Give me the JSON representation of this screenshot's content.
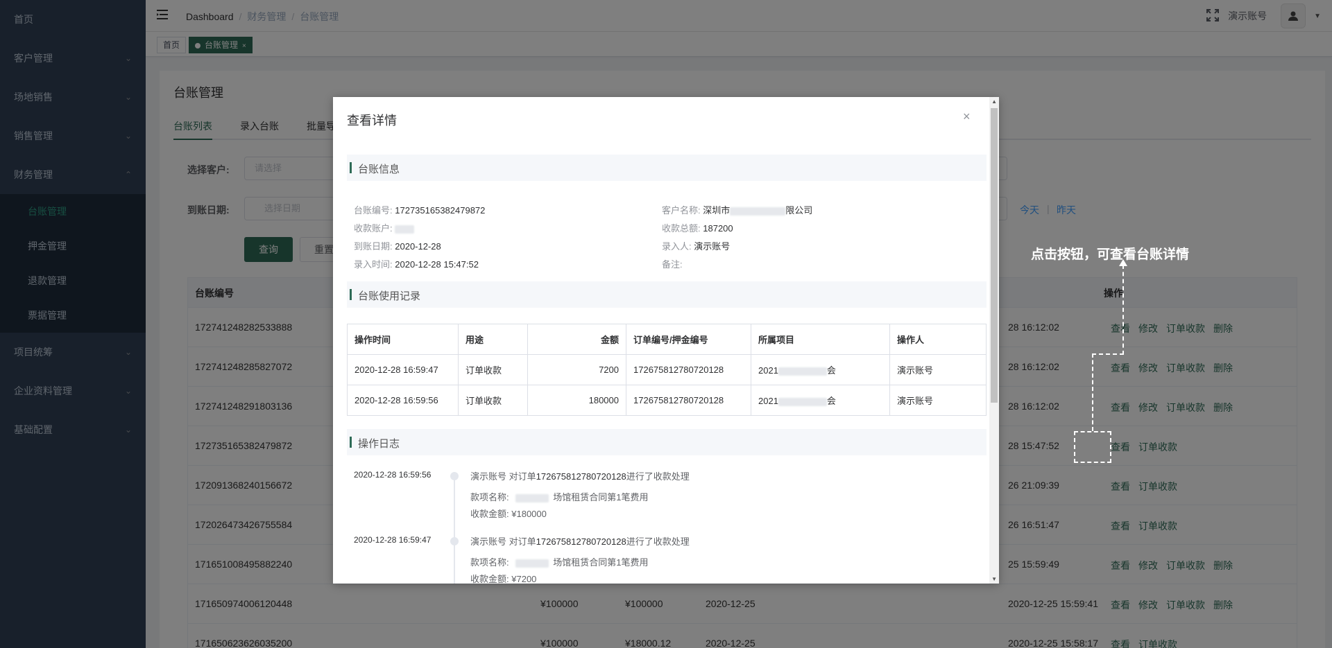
{
  "sidebar": {
    "items": [
      {
        "label": "首页",
        "has_arrow": false
      },
      {
        "label": "客户管理",
        "has_arrow": true
      },
      {
        "label": "场地销售",
        "has_arrow": true
      },
      {
        "label": "销售管理",
        "has_arrow": true
      },
      {
        "label": "财务管理",
        "has_arrow": true,
        "expanded": true
      }
    ],
    "sub_items": [
      {
        "label": "台账管理",
        "active": true
      },
      {
        "label": "押金管理"
      },
      {
        "label": "退款管理"
      },
      {
        "label": "票据管理"
      }
    ],
    "items_after": [
      {
        "label": "项目统筹"
      },
      {
        "label": "企业资料管理"
      },
      {
        "label": "基础配置"
      }
    ],
    "arrow_down": "⌄",
    "arrow_up": "⌃"
  },
  "navbar": {
    "breadcrumb": [
      "Dashboard",
      "财务管理",
      "台账管理"
    ],
    "username": "演示账号"
  },
  "tags": [
    {
      "label": "首页"
    },
    {
      "label": "台账管理",
      "active": true
    }
  ],
  "page": {
    "title": "台账管理",
    "tabs": [
      "台账列表",
      "录入台账",
      "批量导"
    ],
    "filters": {
      "customer_label": "选择客户:",
      "customer_placeholder": "请选择",
      "date_label": "到账日期:",
      "date_placeholder": "选择日期",
      "today": "今天",
      "yesterday": "昨天",
      "divider": "|"
    },
    "query_button": "查询",
    "reset_button": "重置"
  },
  "bg_table": {
    "headers": {
      "id": "台账编号",
      "ops": "操作"
    },
    "rows": [
      {
        "id": "172741248282533888",
        "time": "28 16:12:02",
        "ops": [
          "查看",
          "修改",
          "订单收款",
          "删除"
        ]
      },
      {
        "id": "172741248285827072",
        "time": "28 16:12:02",
        "ops": [
          "查看",
          "修改",
          "订单收款",
          "删除"
        ]
      },
      {
        "id": "172741248291803136",
        "time": "28 16:12:02",
        "ops": [
          "查看",
          "修改",
          "订单收款",
          "删除"
        ]
      },
      {
        "id": "172735165382479872",
        "time": "28 15:47:52",
        "ops": [
          "查看",
          "订单收款"
        ]
      },
      {
        "id": "172091368240156672",
        "time": "26 21:09:39",
        "ops": [
          "查看",
          "订单收款"
        ]
      },
      {
        "id": "172026473426755584",
        "time": "26 16:51:47",
        "ops": [
          "查看",
          "订单收款"
        ]
      },
      {
        "id": "171651008495882240",
        "time": "25 15:59:49",
        "ops": [
          "查看",
          "修改",
          "订单收款",
          "删除"
        ]
      },
      {
        "id": "171650974006120448",
        "time": "2020-12-25 15:59:41",
        "ops": [
          "查看",
          "修改",
          "订单收款",
          "删除"
        ],
        "amount1": "¥100000",
        "amount2": "¥100000",
        "date": "2020-12-25"
      },
      {
        "id": "171650623626035200",
        "time": "2020-12-25 15:58:17",
        "ops": [
          "查看",
          "订单收款"
        ],
        "amount1": "¥100000",
        "amount2": "¥18000.12",
        "date": "2020-12-25"
      }
    ]
  },
  "dialog": {
    "title": "查看详情",
    "close": "×",
    "sections": {
      "info": "台账信息",
      "usage": "台账使用记录",
      "log": "操作日志"
    },
    "info": {
      "ledger_no_label": "台账编号:",
      "ledger_no": "172735165382479872",
      "customer_label": "客户名称:",
      "customer_prefix": "深圳市",
      "customer_suffix": "限公司",
      "account_label": "收款账户:",
      "total_label": "收款总额:",
      "total": "187200",
      "arrival_label": "到账日期:",
      "arrival": "2020-12-28",
      "entered_by_label": "录入人:",
      "entered_by": "演示账号",
      "entry_time_label": "录入时间:",
      "entry_time": "2020-12-28 15:47:52",
      "remark_label": "备注:"
    },
    "usage_table": {
      "headers": [
        "操作时间",
        "用途",
        "金额",
        "订单编号/押金编号",
        "所属项目",
        "操作人"
      ],
      "rows": [
        {
          "time": "2020-12-28 16:59:47",
          "purpose": "订单收款",
          "amount": "7200",
          "order": "172675812780720128",
          "project_prefix": "2021",
          "project_suffix": "会",
          "operator": "演示账号"
        },
        {
          "time": "2020-12-28 16:59:56",
          "purpose": "订单收款",
          "amount": "180000",
          "order": "172675812780720128",
          "project_prefix": "2021",
          "project_suffix": "会",
          "operator": "演示账号"
        }
      ]
    },
    "log": [
      {
        "time": "2020-12-28 16:59:56",
        "action_prefix": "演示账号 对订单",
        "order": "172675812780720128",
        "action_suffix": "进行了收款处理",
        "item_label": "款项名称:",
        "item_suffix": "场馆租赁合同第1笔费用",
        "amount_label": "收款金额:",
        "amount": "¥180000"
      },
      {
        "time": "2020-12-28 16:59:47",
        "action_prefix": "演示账号 对订单",
        "order": "172675812780720128",
        "action_suffix": "进行了收款处理",
        "item_label": "款项名称:",
        "item_suffix": "场馆租赁合同第1笔费用",
        "amount_label": "收款金额:",
        "amount": "¥7200"
      }
    ]
  },
  "annotation": {
    "text": "点击按钮，可查看台账详情"
  },
  "colors": {
    "sidebar_bg": "#304156",
    "primary": "#2e6b57",
    "active_menu": "#2e9e84"
  }
}
